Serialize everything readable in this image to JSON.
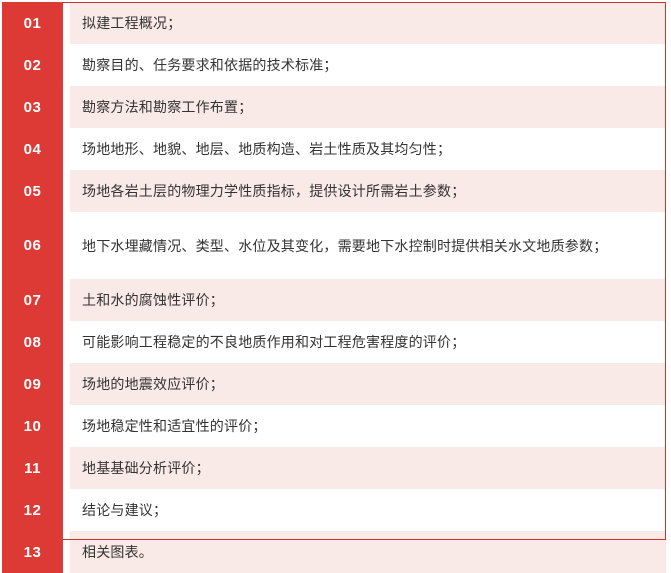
{
  "table": {
    "accent_color": "#dd3a35",
    "alt_row_color": "#f9eae7",
    "plain_row_color": "#ffffff",
    "text_color": "#333333",
    "rows": [
      {
        "number": "01",
        "text": "拟建工程概况；"
      },
      {
        "number": "02",
        "text": "勘察目的、任务要求和依据的技术标准；"
      },
      {
        "number": "03",
        "text": "勘察方法和勘察工作布置；"
      },
      {
        "number": "04",
        "text": "场地地形、地貌、地层、地质构造、岩土性质及其均匀性；"
      },
      {
        "number": "05",
        "text": "场地各岩土层的物理力学性质指标，提供设计所需岩土参数；"
      },
      {
        "number": "06",
        "text": "地下水埋藏情况、类型、水位及其变化，需要地下水控制时提供相关水文地质参数；"
      },
      {
        "number": "07",
        "text": "土和水的腐蚀性评价；"
      },
      {
        "number": "08",
        "text": "可能影响工程稳定的不良地质作用和对工程危害程度的评价；"
      },
      {
        "number": "09",
        "text": "场地的地震效应评价；"
      },
      {
        "number": "10",
        "text": "场地稳定性和适宜性的评价；"
      },
      {
        "number": "11",
        "text": "地基基础分析评价；"
      },
      {
        "number": "12",
        "text": "结论与建议；"
      },
      {
        "number": "13",
        "text": "相关图表。"
      }
    ]
  }
}
